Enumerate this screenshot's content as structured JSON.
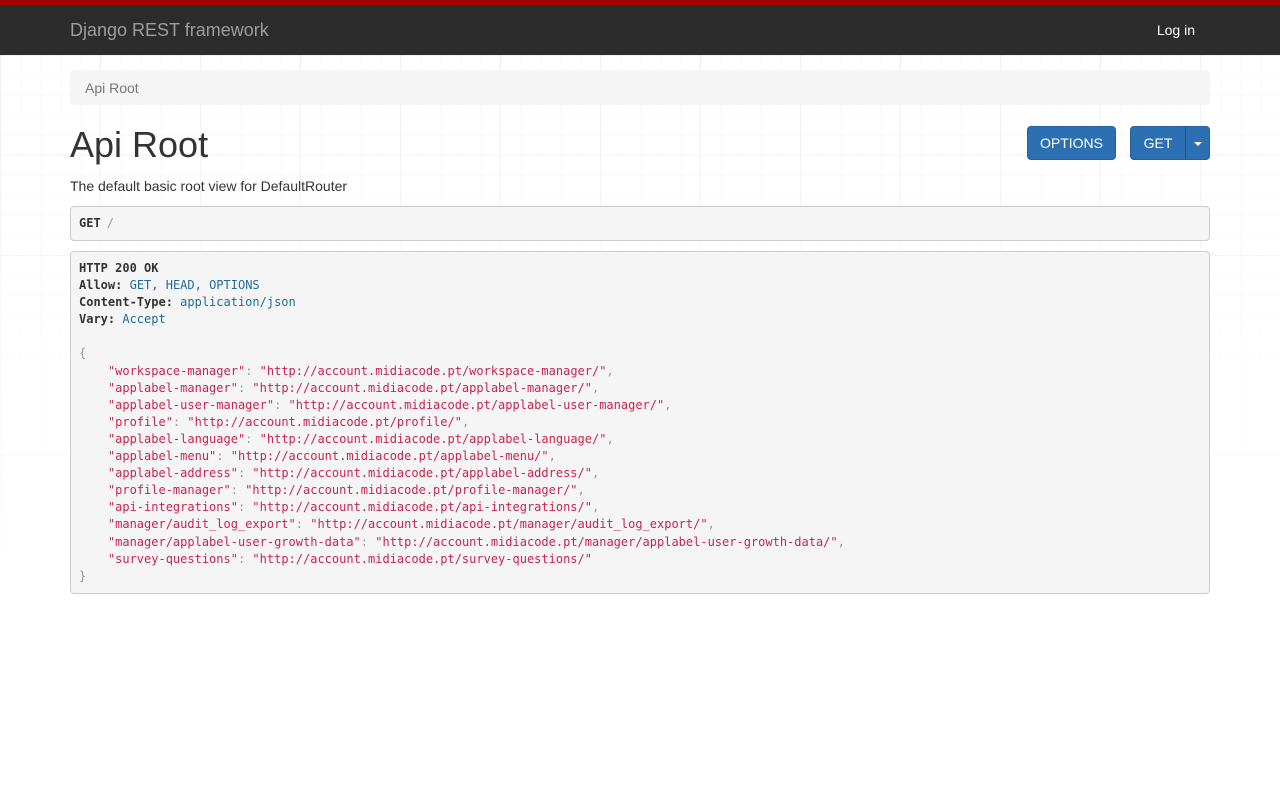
{
  "navbar": {
    "brand": "Django REST framework",
    "login": "Log in"
  },
  "breadcrumb": [
    "Api Root"
  ],
  "page": {
    "title": "Api Root",
    "description": "The default basic root view for DefaultRouter"
  },
  "buttons": {
    "options": "OPTIONS",
    "get": "GET"
  },
  "request": {
    "method": "GET",
    "path": "/"
  },
  "response": {
    "status": "HTTP 200 OK",
    "headers": [
      {
        "key": "Allow:",
        "value": "GET, HEAD, OPTIONS"
      },
      {
        "key": "Content-Type:",
        "value": "application/json"
      },
      {
        "key": "Vary:",
        "value": "Accept"
      }
    ],
    "body": [
      {
        "key": "workspace-manager",
        "value": "http://account.midiacode.pt/workspace-manager/"
      },
      {
        "key": "applabel-manager",
        "value": "http://account.midiacode.pt/applabel-manager/"
      },
      {
        "key": "applabel-user-manager",
        "value": "http://account.midiacode.pt/applabel-user-manager/"
      },
      {
        "key": "profile",
        "value": "http://account.midiacode.pt/profile/"
      },
      {
        "key": "applabel-language",
        "value": "http://account.midiacode.pt/applabel-language/"
      },
      {
        "key": "applabel-menu",
        "value": "http://account.midiacode.pt/applabel-menu/"
      },
      {
        "key": "applabel-address",
        "value": "http://account.midiacode.pt/applabel-address/"
      },
      {
        "key": "profile-manager",
        "value": "http://account.midiacode.pt/profile-manager/"
      },
      {
        "key": "api-integrations",
        "value": "http://account.midiacode.pt/api-integrations/"
      },
      {
        "key": "manager/audit_log_export",
        "value": "http://account.midiacode.pt/manager/audit_log_export/"
      },
      {
        "key": "manager/applabel-user-growth-data",
        "value": "http://account.midiacode.pt/manager/applabel-user-growth-data/"
      },
      {
        "key": "survey-questions",
        "value": "http://account.midiacode.pt/survey-questions/"
      }
    ]
  },
  "colors": {
    "navbar_bg": "#2c2c2c",
    "navbar_accent": "#a30000",
    "button_primary": "#2c6fb3",
    "json_string": "#c7254e",
    "header_value": "#1f6b9a"
  }
}
